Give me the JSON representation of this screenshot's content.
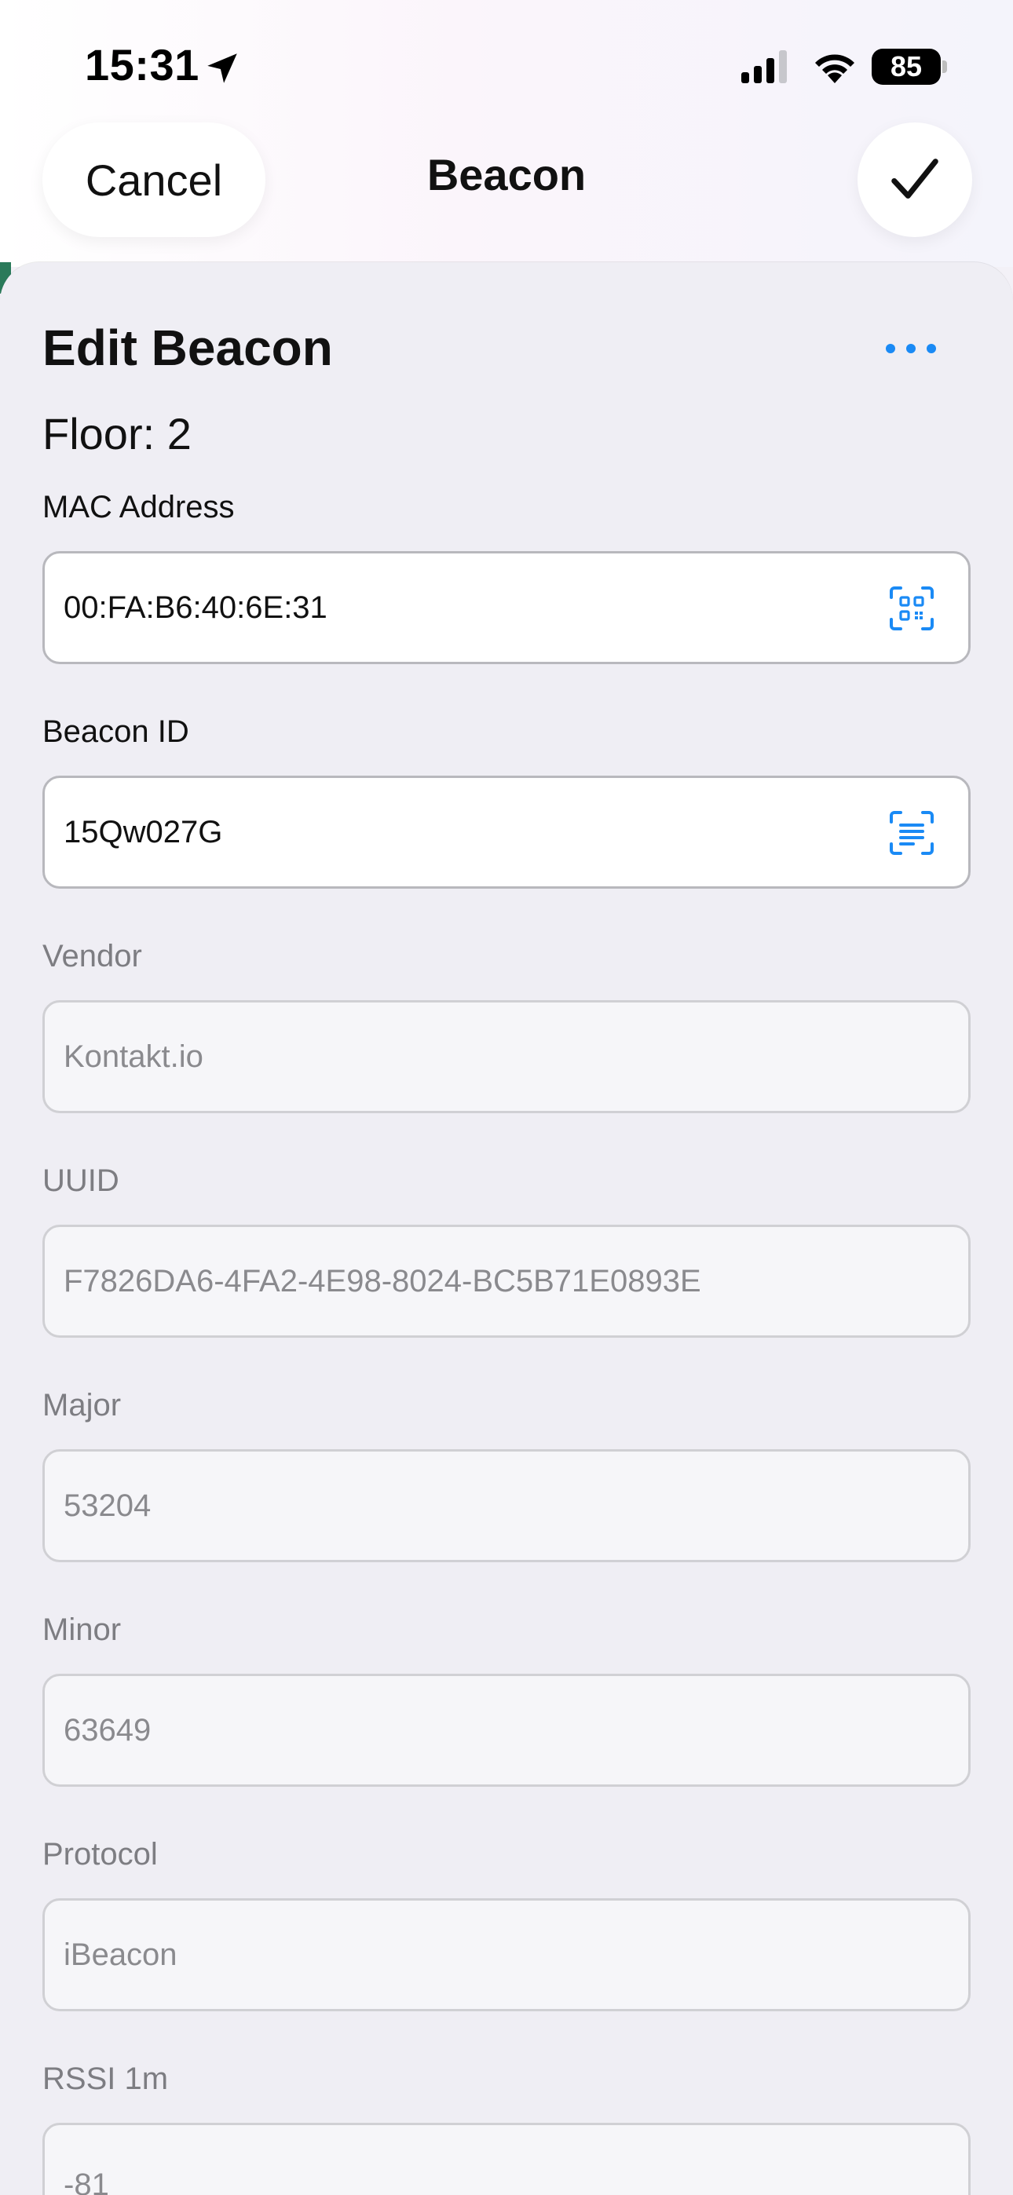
{
  "status_bar": {
    "time": "15:31",
    "battery": "85"
  },
  "nav": {
    "cancel_label": "Cancel",
    "title": "Beacon"
  },
  "sheet": {
    "title": "Edit Beacon",
    "floor": "Floor: 2"
  },
  "fields": {
    "mac": {
      "label": "MAC Address",
      "value": "00:FA:B6:40:6E:31"
    },
    "beacon_id": {
      "label": "Beacon ID",
      "value": "15Qw027G"
    },
    "vendor": {
      "label": "Vendor",
      "value": "Kontakt.io"
    },
    "uuid": {
      "label": "UUID",
      "value": "F7826DA6-4FA2-4E98-8024-BC5B71E0893E"
    },
    "major": {
      "label": "Major",
      "value": "53204"
    },
    "minor": {
      "label": "Minor",
      "value": "63649"
    },
    "protocol": {
      "label": "Protocol",
      "value": "iBeacon"
    },
    "rssi": {
      "label": "RSSI 1m",
      "value": "-81"
    }
  },
  "colors": {
    "accent": "#1a8af5",
    "sheet_bg": "#efeef4"
  }
}
